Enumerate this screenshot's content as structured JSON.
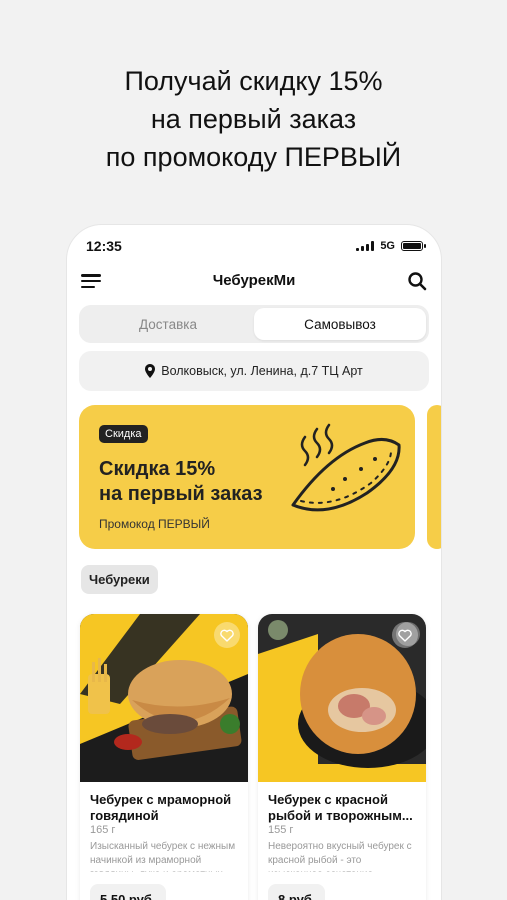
{
  "headline": {
    "line1": "Получай скидку 15%",
    "line2": "на первый заказ",
    "line3": "по промокоду ПЕРВЫЙ"
  },
  "status_bar": {
    "time": "12:35",
    "network": "5G"
  },
  "header": {
    "title": "ЧебурекМи",
    "menu_icon": "hamburger-icon",
    "search_icon": "search-icon"
  },
  "delivery_toggle": {
    "options": [
      "Доставка",
      "Самовывоз"
    ],
    "selected": "Самовывоз"
  },
  "address": {
    "text": "Волковыск, ул. Ленина, д.7 ТЦ Арт",
    "icon": "location-pin-icon"
  },
  "promo_banner": {
    "tag": "Скидка",
    "title_line1": "Скидка 15%",
    "title_line2": "на первый заказ",
    "code": "Промокод ПЕРВЫЙ",
    "color": "#f6cd48"
  },
  "category": {
    "label": "Чебуреки"
  },
  "products": [
    {
      "name": "Чебурек с мраморной говядиной",
      "weight": "165 г",
      "description": "Изысканный чебурек с нежным начинкой из мраморной говядины, лука и ароматных специй,...",
      "price": "5,50 руб."
    },
    {
      "name": "Чебурек с красной рыбой и творожным...",
      "weight": "155 г",
      "description": "Невероятно вкусный чебурек с красной рыбой - это изысканное сочетание хрустящего теста и...",
      "price": "8 руб."
    }
  ]
}
